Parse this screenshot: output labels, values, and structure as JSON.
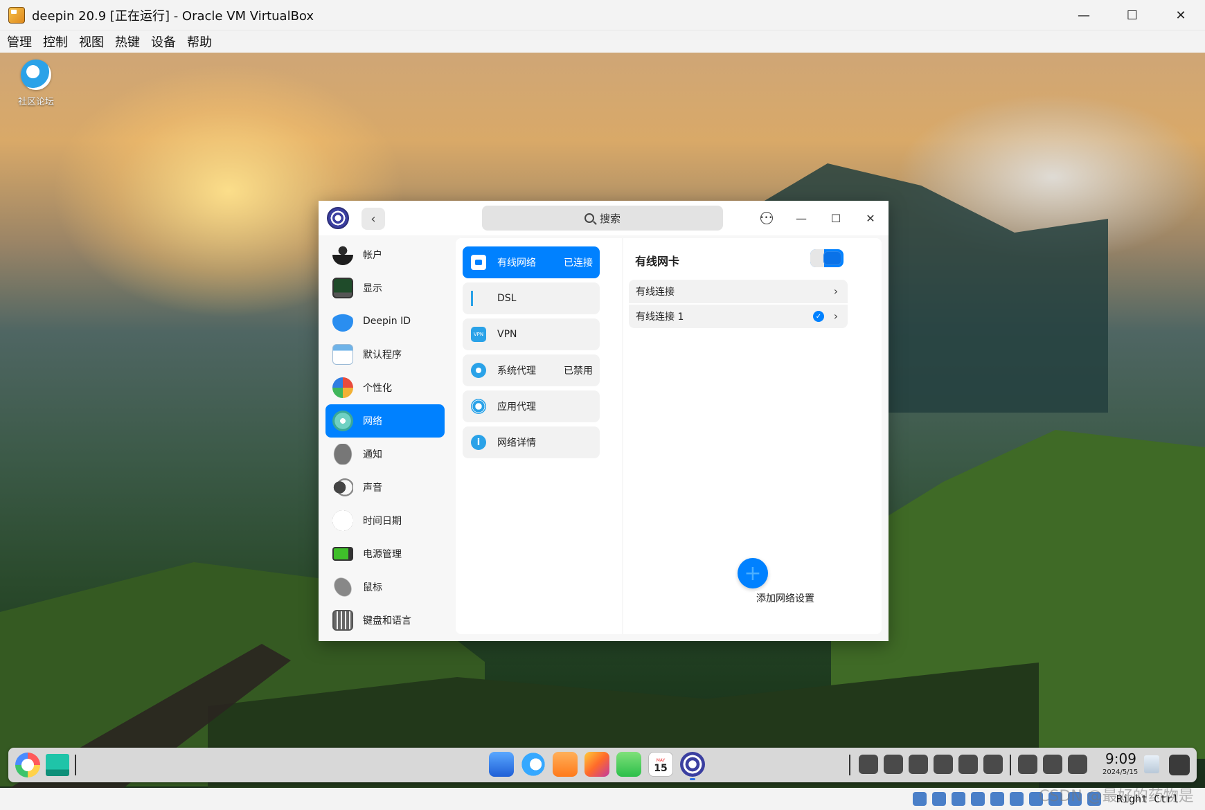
{
  "host_window": {
    "title": "deepin 20.9 [正在运行] - Oracle VM VirtualBox",
    "menu": [
      "管理",
      "控制",
      "视图",
      "热键",
      "设备",
      "帮助"
    ],
    "buttons": {
      "minimize": "—",
      "maximize": "☐",
      "close": "✕"
    }
  },
  "desktop": {
    "icons": [
      {
        "label": "社区论坛",
        "icon": "deepin-forum-icon"
      }
    ]
  },
  "control_center": {
    "back_glyph": "‹",
    "search_placeholder": "搜索",
    "titlebar": {
      "more": "•••",
      "minimize": "—",
      "maximize": "☐",
      "close": "✕"
    },
    "nav": [
      {
        "label": "帐户",
        "icon": "account-icon",
        "active": false
      },
      {
        "label": "显示",
        "icon": "display-icon",
        "active": false
      },
      {
        "label": "Deepin ID",
        "icon": "cloud-icon",
        "active": false
      },
      {
        "label": "默认程序",
        "icon": "default-apps-icon",
        "active": false
      },
      {
        "label": "个性化",
        "icon": "personalization-icon",
        "active": false
      },
      {
        "label": "网络",
        "icon": "network-icon",
        "active": true
      },
      {
        "label": "通知",
        "icon": "bell-icon",
        "active": false
      },
      {
        "label": "声音",
        "icon": "speaker-icon",
        "active": false
      },
      {
        "label": "时间日期",
        "icon": "clock-icon",
        "active": false
      },
      {
        "label": "电源管理",
        "icon": "battery-icon",
        "active": false
      },
      {
        "label": "鼠标",
        "icon": "mouse-icon",
        "active": false
      },
      {
        "label": "键盘和语言",
        "icon": "keyboard-icon",
        "active": false
      }
    ],
    "network_menu": [
      {
        "label": "有线网络",
        "status": "已连接",
        "icon": "wired-icon",
        "active": true
      },
      {
        "label": "DSL",
        "status": "",
        "icon": "dsl-icon",
        "active": false
      },
      {
        "label": "VPN",
        "status": "",
        "icon": "vpn-icon",
        "active": false
      },
      {
        "label": "系统代理",
        "status": "已禁用",
        "icon": "proxy-icon",
        "active": false
      },
      {
        "label": "应用代理",
        "status": "",
        "icon": "app-proxy-icon",
        "active": false
      },
      {
        "label": "网络详情",
        "status": "",
        "icon": "info-icon",
        "active": false
      }
    ],
    "vpn_icon_text": "VPN",
    "info_icon_text": "i",
    "detail": {
      "title": "有线网卡",
      "toggle_on": true,
      "connections": [
        {
          "label": "有线连接",
          "checked": false
        },
        {
          "label": "有线连接 1",
          "checked": true
        }
      ],
      "chevron": "›",
      "check": "✓",
      "add_glyph": "+",
      "add_label": "添加网络设置"
    }
  },
  "dock": {
    "calendar_day": "15",
    "calendar_month": "MAY",
    "time": "9:09",
    "date": "2024/5/15"
  },
  "status_bar": {
    "host_key": "Right Ctrl",
    "watermark": "CSDN @最好的药物是乌梅"
  }
}
